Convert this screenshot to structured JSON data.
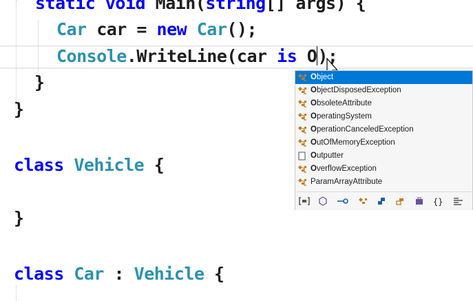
{
  "code": {
    "line1": {
      "kw1": "static",
      "kw2": "void",
      "name": "Main(",
      "type": "string",
      "rest": "[] args) {"
    },
    "line2": {
      "type1": "Car",
      "var": " car = ",
      "kw": "new",
      "type2": "Car",
      "rest": "();"
    },
    "line3": {
      "type": "Console",
      "call": ".WriteLine(car ",
      "kw": "is",
      "typed": " O",
      "after": ");"
    },
    "line4": "}",
    "line5": "}",
    "line6": {
      "kw": "class",
      "type": "Vehicle",
      "rest": " {"
    },
    "line7": "}",
    "line8": {
      "kw": "class",
      "type": "Car",
      "sep": " : ",
      "base": "Vehicle",
      "rest": " {"
    }
  },
  "completion": {
    "items": [
      {
        "first": "O",
        "rest": "bject",
        "icon": "class-icon",
        "selected": true
      },
      {
        "first": "O",
        "rest": "bjectDisposedException",
        "icon": "class-icon"
      },
      {
        "first": "O",
        "rest": "bsoleteAttribute",
        "icon": "class-icon"
      },
      {
        "first": "O",
        "rest": "peratingSystem",
        "icon": "class-icon"
      },
      {
        "first": "O",
        "rest": "perationCanceledException",
        "icon": "class-icon"
      },
      {
        "first": "O",
        "rest": "utOfMemoryException",
        "icon": "class-icon"
      },
      {
        "first": "O",
        "rest": "utputter",
        "icon": "snippet-icon"
      },
      {
        "first": "O",
        "rest": "verflowException",
        "icon": "class-icon"
      },
      {
        "first": "",
        "rest": "ParamArrayAttribute",
        "icon": "class-icon"
      }
    ],
    "filters": [
      "namespace-filter-icon",
      "interface-filter-icon",
      "delegate-filter-icon",
      "class-filter-icon",
      "struct-filter-icon",
      "enum-filter-icon",
      "module-filter-icon",
      "keyword-filter-icon",
      "snippet-filter-icon"
    ]
  },
  "colors": {
    "keyword": "#0000ff",
    "type": "#2b91af",
    "selection": "#0078d7",
    "class_icon": "#c27d1a"
  }
}
